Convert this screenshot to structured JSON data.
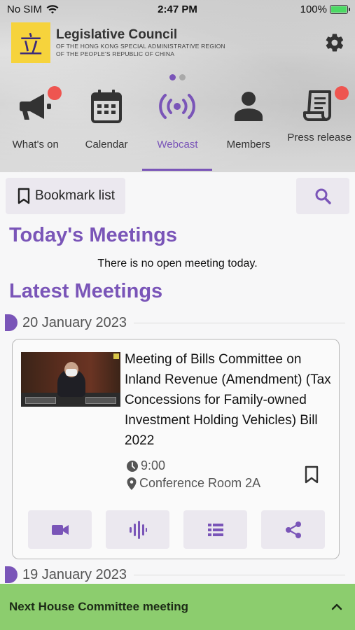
{
  "status_bar": {
    "carrier": "No SIM",
    "time": "2:47 PM",
    "battery": "100%"
  },
  "header": {
    "logo_char": "立",
    "title": "Legislative Council",
    "subtitle_1": "OF THE HONG KONG SPECIAL ADMINISTRATIVE REGION",
    "subtitle_2": "OF THE PEOPLE'S REPUBLIC OF CHINA"
  },
  "nav": {
    "items": [
      {
        "label": "What's on",
        "icon": "megaphone-icon",
        "badge": true
      },
      {
        "label": "Calendar",
        "icon": "calendar-icon",
        "badge": false
      },
      {
        "label": "Webcast",
        "icon": "webcast-icon",
        "badge": false,
        "active": true
      },
      {
        "label": "Members",
        "icon": "person-icon",
        "badge": false
      },
      {
        "label": "Press release",
        "icon": "press-release-icon",
        "badge": true
      }
    ],
    "page_dots": 2,
    "active_dot": 1
  },
  "toolbar": {
    "bookmark_label": "Bookmark list"
  },
  "todays_meetings": {
    "heading": "Today's Meetings",
    "empty_message": "There is no open meeting today."
  },
  "latest_meetings": {
    "heading": "Latest Meetings",
    "groups": [
      {
        "date": "20 January 2023",
        "meeting": {
          "title": "Meeting of Bills Committee on Inland Revenue (Amendment) (Tax Concessions for Family-owned Investment Holding Vehicles) Bill 2022",
          "time": "9:00",
          "venue": "Conference Room 2A"
        }
      },
      {
        "date": "19 January 2023"
      }
    ]
  },
  "bottom_bar": {
    "label": "Next House Committee meeting"
  },
  "colors": {
    "accent": "#7a55b8",
    "badge": "#ee5550",
    "bottom_bar": "#8ccd6e",
    "logo_bg": "#f6d33c"
  }
}
